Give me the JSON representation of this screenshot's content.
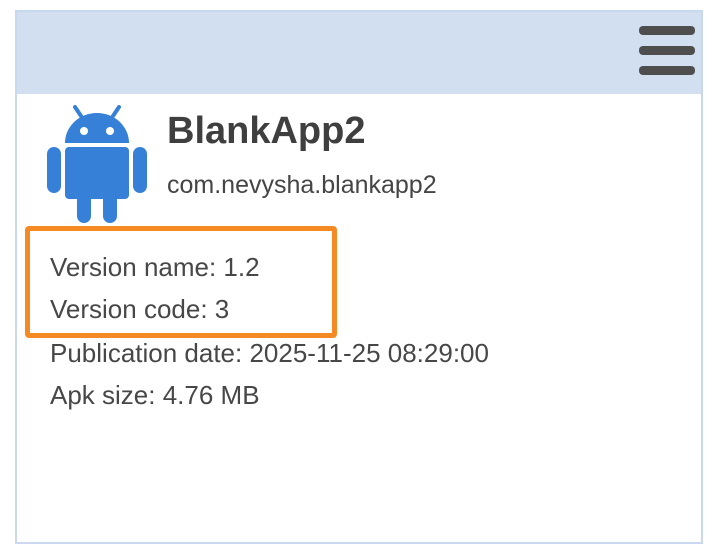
{
  "header": {
    "menu_icon": "hamburger-menu-icon",
    "background_color": "#d2dff0"
  },
  "app": {
    "icon": "android-icon",
    "icon_color": "#3680d8",
    "name": "BlankApp2",
    "package": "com.nevysha.blankapp2"
  },
  "info": {
    "version_name": "Version name: 1.2",
    "version_code": "Version code: 3",
    "publication_date": "Publication date: 2025-11-25 08:29:00",
    "apk_size": "Apk size: 4.76 MB"
  },
  "highlight": {
    "color": "#f58a24"
  }
}
